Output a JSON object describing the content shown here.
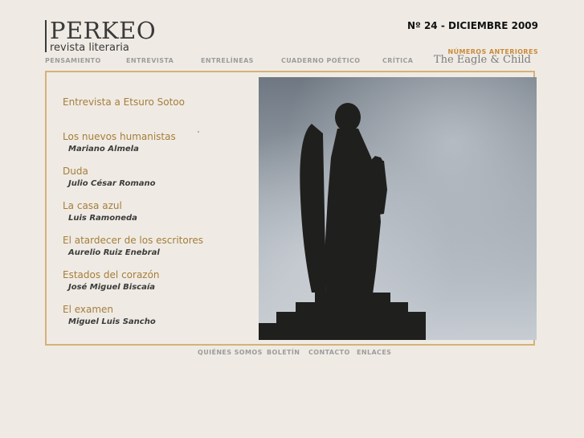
{
  "site": {
    "title": "PERKEO",
    "subtitle": "revista literaria"
  },
  "issue": "Nº 24 - DICIEMBRE 2009",
  "links": {
    "back_issues": "NÚMEROS ANTERIORES",
    "eagle": "The Eagle & Child"
  },
  "topnav": [
    "PENSAMIENTO",
    "ENTREVISTA",
    "ENTRELÍNEAS",
    "CUADERNO POÉTICO",
    "CRÍTICA"
  ],
  "featured": "Entrevista a Etsuro Sotoo",
  "articles": [
    {
      "title": "Los nuevos humanistas",
      "author": "Mariano Almela"
    },
    {
      "title": "Duda",
      "author": "Julio César Romano"
    },
    {
      "title": "La casa azul",
      "author": "Luis Ramoneda"
    },
    {
      "title": "El atardecer de los escritores",
      "author": "Aurelio Ruiz Enebral"
    },
    {
      "title": "Estados del corazón",
      "author": "José Miguel Biscaía"
    },
    {
      "title": "El examen",
      "author": "Miguel Luis Sancho"
    }
  ],
  "bottomnav": [
    "QUIÉNES SOMOS",
    "BOLETÍN",
    "CONTACTO",
    "ENLACES"
  ],
  "colors": {
    "background": "#efebe4",
    "accent": "#a67d3b",
    "frame": "#d4b278",
    "nav": "#9c9c9c"
  }
}
